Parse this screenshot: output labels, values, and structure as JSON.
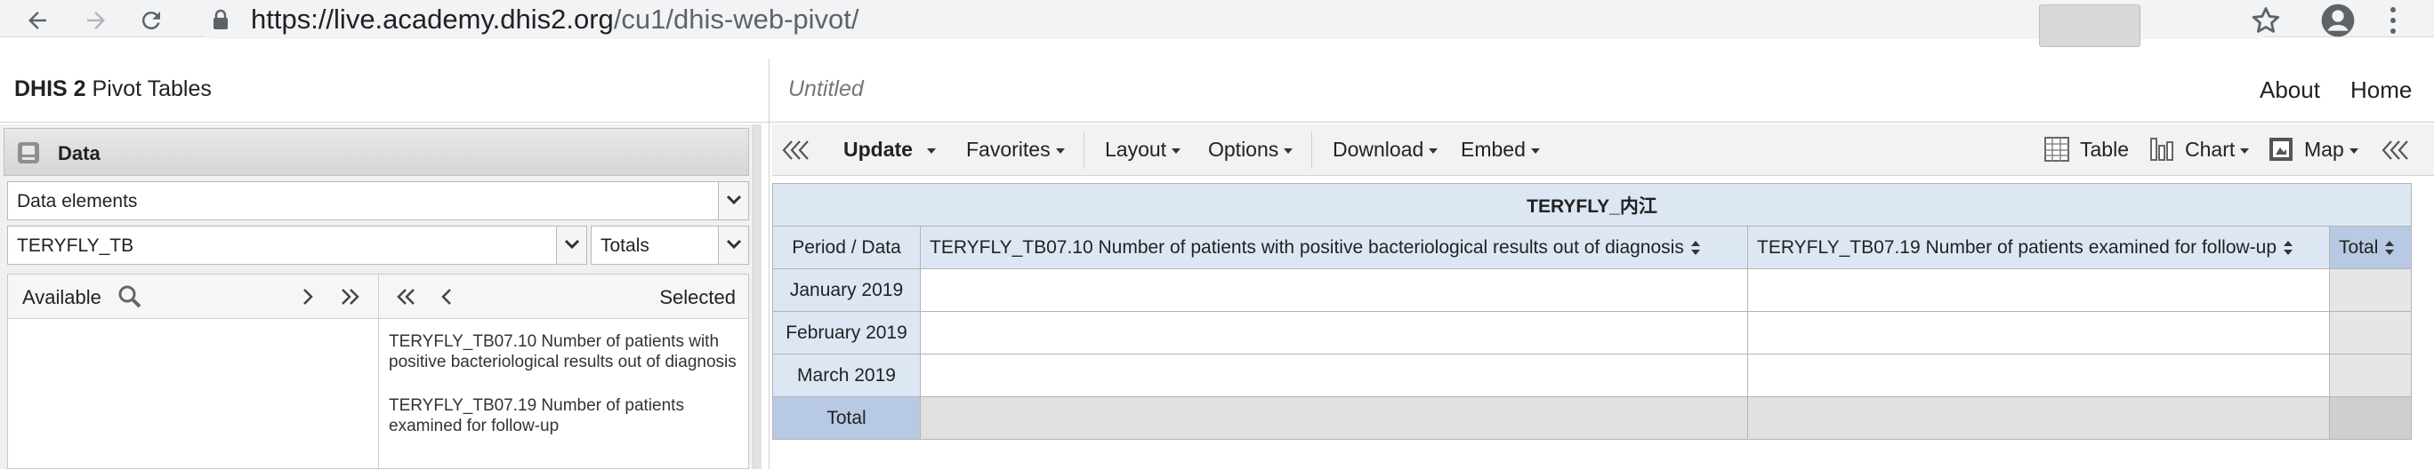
{
  "browser": {
    "url_host": "https://live.academy.dhis2.org",
    "url_path": "/cu1/dhis-web-pivot/"
  },
  "header": {
    "brand_bold": "DHIS 2",
    "brand_rest": " Pivot Tables",
    "favorite_title": "Untitled",
    "links": [
      "About",
      "Home"
    ]
  },
  "left_panel": {
    "data_label": "Data",
    "data_type": "Data elements",
    "data_group": "TERYFLY_TB",
    "detail": "Totals",
    "available_label": "Available",
    "selected_label": "Selected",
    "selected_items": [
      "TERYFLY_TB07.10 Number of patients with positive bacteriological results out of diagnosis",
      "TERYFLY_TB07.19 Number of patients examined for follow-up"
    ]
  },
  "toolbar": {
    "update": "Update",
    "favorites": "Favorites",
    "layout": "Layout",
    "options": "Options",
    "download": "Download",
    "embed": "Embed",
    "table": "Table",
    "chart": "Chart",
    "map": "Map"
  },
  "pivot": {
    "org_unit": "TERYFLY_内江",
    "corner": "Period / Data",
    "columns": [
      "TERYFLY_TB07.10 Number of patients with positive bacteriological results out of diagnosis",
      "TERYFLY_TB07.19 Number of patients examined for follow-up",
      "Total"
    ],
    "rows": [
      "January 2019",
      "February 2019",
      "March 2019"
    ],
    "total_label": "Total"
  },
  "colors": {
    "header_blue": "#dde7f4",
    "total_blue": "#b7c9e3"
  }
}
